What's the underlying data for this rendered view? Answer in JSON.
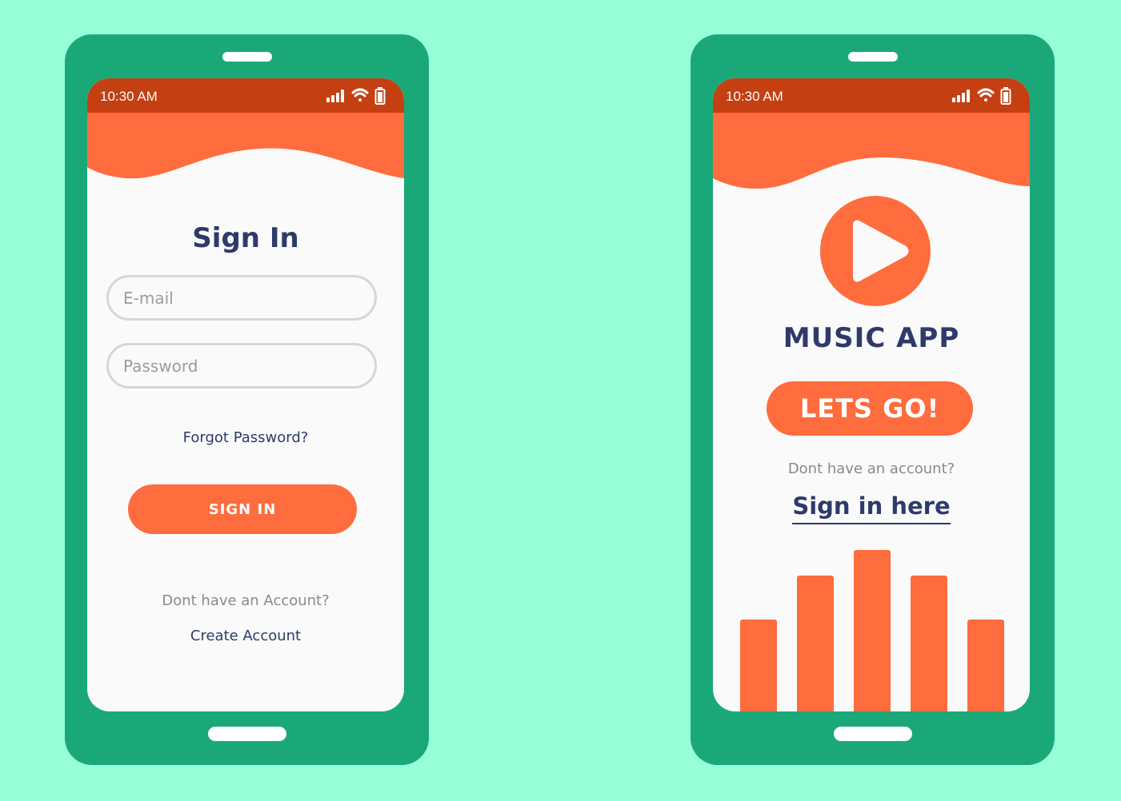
{
  "colors": {
    "background": "#96FFD8",
    "phone_body": "#1BA878",
    "status_bar": "#C43F12",
    "accent": "#FF6C3D",
    "heading": "#2E3A6B",
    "muted_text": "#8A8A8A"
  },
  "left_phone": {
    "status": {
      "time": "10:30 AM",
      "icons": [
        "signal-icon",
        "wifi-icon",
        "battery-icon"
      ]
    },
    "title": "Sign In",
    "email_placeholder": "E-mail",
    "password_placeholder": "Password",
    "forgot_password": "Forgot Password?",
    "sign_in_button": "SIGN IN",
    "no_account_text": "Dont have an Account?",
    "create_account": "Create Account"
  },
  "right_phone": {
    "status": {
      "time": "10:30 AM",
      "icons": [
        "signal-icon",
        "wifi-icon",
        "battery-icon"
      ]
    },
    "logo_icon": "play-icon",
    "title": "MUSIC APP",
    "lets_go_button": "LETS GO!",
    "no_account_text": "Dont have an account?",
    "sign_in_link": "Sign in here",
    "equalizer_levels": [
      0.57,
      0.84,
      1.0,
      0.84,
      0.57
    ]
  }
}
